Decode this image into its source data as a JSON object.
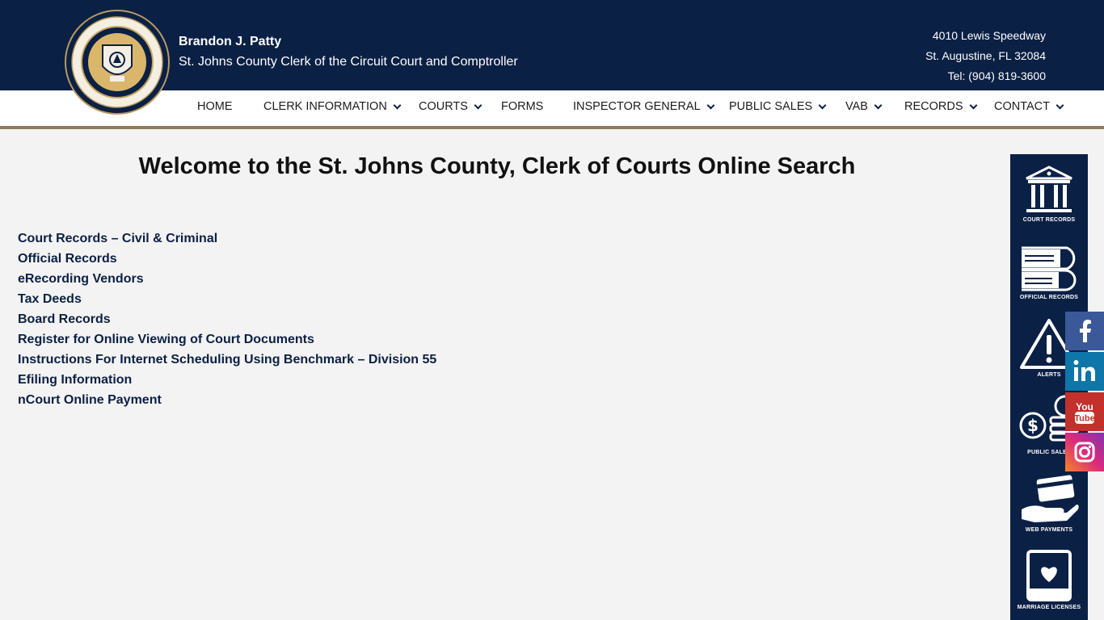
{
  "header": {
    "official_name": "Brandon J. Patty",
    "official_title": "St. Johns County Clerk of the Circuit Court and Comptroller",
    "address_line1": "4010 Lewis Speedway",
    "address_line2": "St. Augustine, FL  32084",
    "phone": "Tel: (904) 819-3600"
  },
  "nav": {
    "items": [
      {
        "label": "HOME",
        "dropdown": false
      },
      {
        "label": "CLERK INFORMATION",
        "dropdown": true
      },
      {
        "label": "COURTS",
        "dropdown": true
      },
      {
        "label": "FORMS",
        "dropdown": false
      },
      {
        "label": "INSPECTOR GENERAL",
        "dropdown": true
      },
      {
        "label": "PUBLIC SALES",
        "dropdown": true
      },
      {
        "label": "VAB",
        "dropdown": true
      },
      {
        "label": "RECORDS",
        "dropdown": true
      },
      {
        "label": "CONTACT",
        "dropdown": true
      }
    ]
  },
  "main": {
    "heading": "Welcome to the St. Johns County, Clerk of Courts Online Search",
    "links": [
      "Court Records – Civil & Criminal",
      "Official Records",
      "eRecording Vendors",
      "Tax Deeds",
      "Board Records",
      "Register for Online Viewing of Court Documents",
      "Instructions For Internet Scheduling Using Benchmark – Division 55",
      "Efiling Information",
      "nCourt Online Payment"
    ]
  },
  "quick_links": {
    "court_records": "COURT RECORDS",
    "official_records": "OFFICIAL RECORDS",
    "alerts": "ALERTS",
    "public_sales": "PUBLIC SALES",
    "web_payments": "WEB PAYMENTS",
    "marriage_licenses": "MARRIAGE LICENSES"
  },
  "social": {
    "youtube_line1": "You",
    "youtube_line2": "Tube"
  },
  "colors": {
    "navy": "#0b2045",
    "gold": "#8d7b58",
    "facebook": "#3b5998",
    "linkedin": "#0e76a8",
    "youtube": "#c4302b",
    "instagram": "#d62976"
  },
  "icons": {
    "seal": "county-clerk-seal",
    "facebook": "facebook-icon",
    "linkedin": "linkedin-icon",
    "youtube": "youtube-icon",
    "instagram": "instagram-icon"
  }
}
